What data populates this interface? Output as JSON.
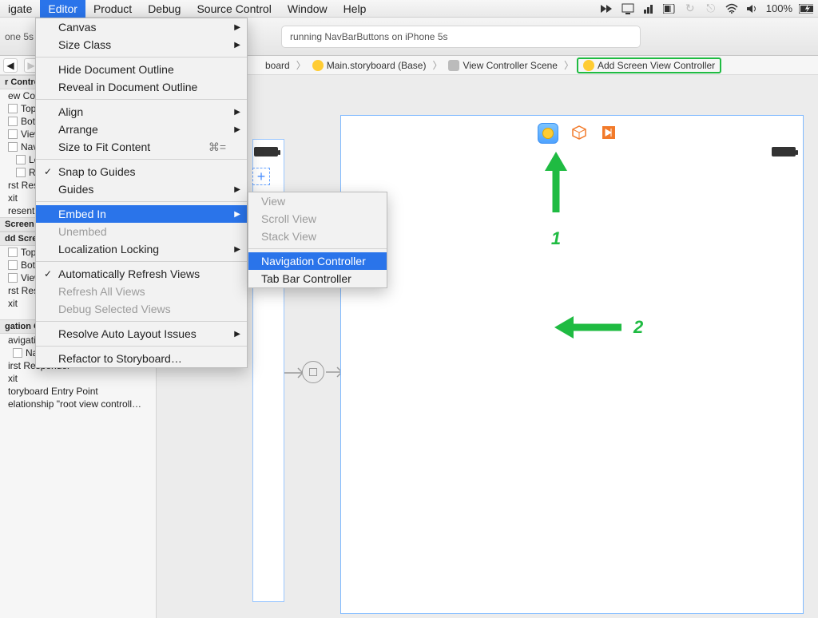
{
  "menubar": {
    "items": [
      "igate",
      "Editor",
      "Product",
      "Debug",
      "Source Control",
      "Window",
      "Help"
    ],
    "selectedIndex": 1,
    "batteryPct": "100%"
  },
  "toolbar": {
    "status": "running NavBarButtons on iPhone 5s",
    "device": "one 5s"
  },
  "breadcrumb": {
    "items": [
      "board",
      "Main.storyboard (Base)",
      "View Controller Scene",
      "Add Screen View Controller"
    ]
  },
  "editorMenu": {
    "items": [
      {
        "label": "Canvas",
        "sub": true
      },
      {
        "label": "Size Class",
        "sub": true
      },
      {
        "sep": true
      },
      {
        "label": "Hide Document Outline"
      },
      {
        "label": "Reveal in Document Outline"
      },
      {
        "sep": true
      },
      {
        "label": "Align",
        "sub": true
      },
      {
        "label": "Arrange",
        "sub": true
      },
      {
        "label": "Size to Fit Content",
        "shortcut": "⌘="
      },
      {
        "sep": true
      },
      {
        "label": "Snap to Guides",
        "check": true
      },
      {
        "label": "Guides",
        "sub": true
      },
      {
        "sep": true
      },
      {
        "label": "Embed In",
        "sub": true,
        "sel": true
      },
      {
        "label": "Unembed",
        "disabled": true
      },
      {
        "label": "Localization Locking",
        "sub": true
      },
      {
        "sep": true
      },
      {
        "label": "Automatically Refresh Views",
        "check": true
      },
      {
        "label": "Refresh All Views",
        "disabled": true
      },
      {
        "label": "Debug Selected Views",
        "disabled": true
      },
      {
        "sep": true
      },
      {
        "label": "Resolve Auto Layout Issues",
        "sub": true
      },
      {
        "sep": true
      },
      {
        "label": "Refactor to Storyboard…"
      }
    ]
  },
  "embedSubmenu": {
    "items": [
      {
        "label": "View",
        "disabled": true
      },
      {
        "label": "Scroll View",
        "disabled": true
      },
      {
        "label": "Stack View",
        "disabled": true
      },
      {
        "sep": true
      },
      {
        "label": "Navigation Controller",
        "sel": true
      },
      {
        "label": "Tab Bar Controller"
      }
    ]
  },
  "outline": {
    "sections": [
      {
        "head": "r Controller",
        "rows": [
          "ew Con",
          "Top La",
          "Bottor",
          "View",
          "Naviga",
          "  Lef",
          "  Rig",
          "rst Resp",
          "xit",
          "resent M"
        ]
      },
      {
        "head": "Screen",
        "rows": []
      },
      {
        "head": "dd Scre",
        "rows": [
          "Top La",
          "Bottor",
          "View",
          "rst Resp",
          "xit"
        ]
      },
      {
        "head": "gation Controller Scene",
        "rows": [
          "avigation Controller",
          "  Navigation Bar",
          "irst Responder",
          "xit",
          "toryboard Entry Point",
          "elationship \"root view controll…"
        ]
      }
    ]
  },
  "annotations": {
    "label1": "1",
    "label2": "2"
  },
  "plus": "+"
}
